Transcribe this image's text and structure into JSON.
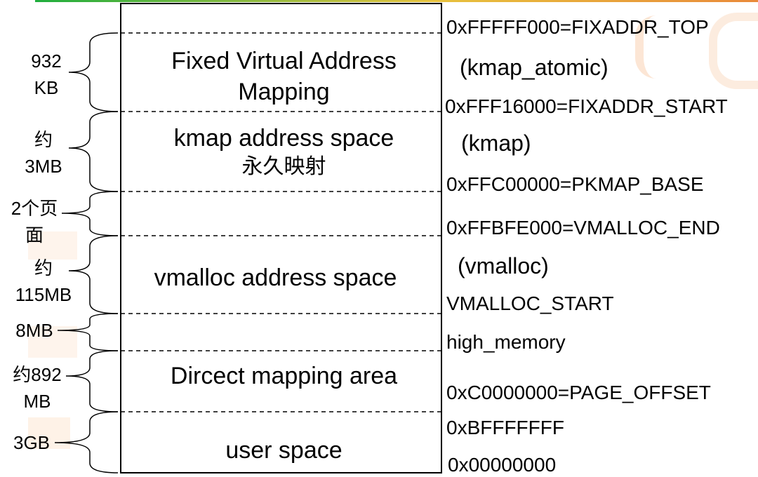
{
  "segments": {
    "fixmap": {
      "line1": "Fixed Virtual Address",
      "line2": "Mapping"
    },
    "kmap": {
      "line1": "kmap address space",
      "line2": "永久映射"
    },
    "vmalloc": {
      "label": "vmalloc address space"
    },
    "direct": {
      "label": "Dircect mapping area"
    },
    "user": {
      "label": "user space"
    }
  },
  "addresses": [
    "0xFFFFF000=FIXADDR_TOP",
    "0xFFF16000=FIXADDR_START",
    "0xFFC00000=PKMAP_BASE",
    "0xFFBFE000=VMALLOC_END",
    "VMALLOC_START",
    "high_memory",
    "0xC0000000=PAGE_OFFSET",
    "0xBFFFFFFF",
    "0x00000000"
  ],
  "annotations": [
    "(kmap_atomic)",
    "(kmap)",
    "(vmalloc)"
  ],
  "sizes": [
    {
      "line1": "932",
      "line2": "KB"
    },
    {
      "line1": "约",
      "line2": "3MB"
    },
    {
      "line1": "2个页",
      "line2": "面"
    },
    {
      "line1": "约",
      "line2": "115MB"
    },
    {
      "line1": "8MB",
      "line2": ""
    },
    {
      "line1": "约892",
      "line2": "MB"
    },
    {
      "line1": "3GB",
      "line2": ""
    }
  ]
}
